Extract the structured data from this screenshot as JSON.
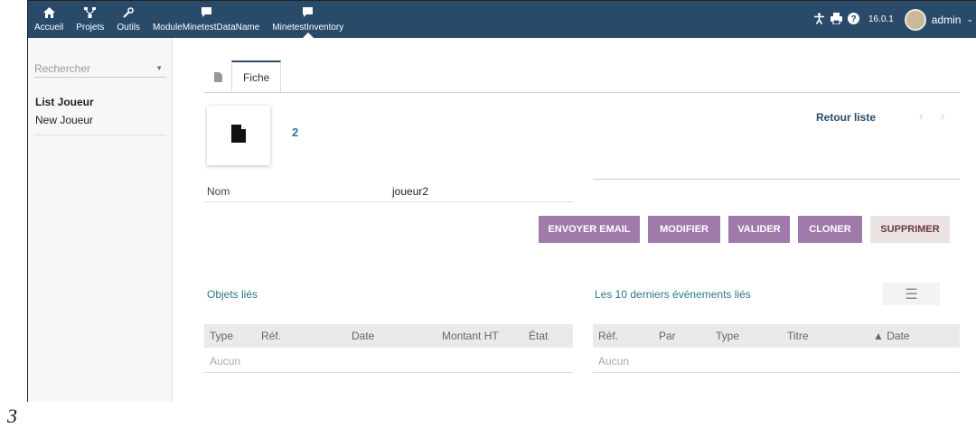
{
  "topbar": {
    "menus": [
      {
        "label": "Accueil",
        "icon": "home-icon"
      },
      {
        "label": "Projets",
        "icon": "sitemap-icon"
      },
      {
        "label": "Outils",
        "icon": "wrench-icon"
      },
      {
        "label": "ModuleMinetestDataName",
        "icon": "comment-icon"
      },
      {
        "label": "MinetestInventory",
        "icon": "comment-icon"
      }
    ],
    "version": "16.0.1",
    "username": "admin"
  },
  "sidebar": {
    "search_placeholder": "Rechercher",
    "items": [
      {
        "label": "List Joueur"
      },
      {
        "label": "New Joueur"
      }
    ]
  },
  "tab": {
    "label": "Fiche"
  },
  "record": {
    "ref": "2",
    "back_link": "Retour liste",
    "field_label": "Nom",
    "field_value": "joueur2"
  },
  "actions": {
    "send_email": "ENVOYER EMAIL",
    "modify": "MODIFIER",
    "validate": "VALIDER",
    "clone": "CLONER",
    "delete": "SUPPRIMER"
  },
  "linked_objects": {
    "title": "Objets liés",
    "columns": [
      "Type",
      "Réf.",
      "Date",
      "Montant HT",
      "État"
    ],
    "empty": "Aucun"
  },
  "events": {
    "title": "Les 10 derniers événements liés",
    "columns": [
      "Réf.",
      "Par",
      "Type",
      "Titre",
      "▲ Date"
    ],
    "empty": "Aucun"
  },
  "page_marker": "3",
  "colors": {
    "topbar": "#2a4a6a",
    "button": "#a07aab",
    "delete_button": "#ece3e3",
    "accent_text": "#2a7a8a"
  }
}
